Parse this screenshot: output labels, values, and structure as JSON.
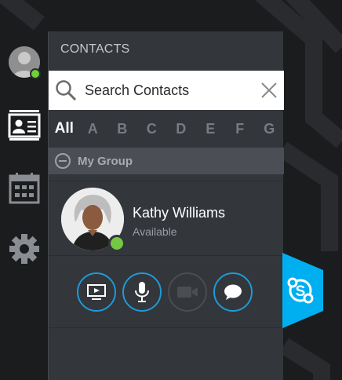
{
  "panel": {
    "title": "CONTACTS"
  },
  "search": {
    "placeholder": "Search Contacts",
    "value": ""
  },
  "alphabet": [
    "All",
    "A",
    "B",
    "C",
    "D",
    "E",
    "F",
    "G"
  ],
  "alphabet_active": "All",
  "group": {
    "label": "My Group",
    "expanded": true
  },
  "contact": {
    "name": "Kathy Williams",
    "status": "Available",
    "status_color": "#75c843"
  },
  "actions": [
    {
      "icon": "screen-share-icon",
      "enabled": true
    },
    {
      "icon": "microphone-icon",
      "enabled": true
    },
    {
      "icon": "video-camera-icon",
      "enabled": false
    },
    {
      "icon": "chat-bubble-icon",
      "enabled": true
    }
  ],
  "colors": {
    "accent": "#1e9ad6",
    "panel_bg": "#33363b",
    "presence_available": "#6fcf3c",
    "skype_blue": "#00aff0"
  }
}
